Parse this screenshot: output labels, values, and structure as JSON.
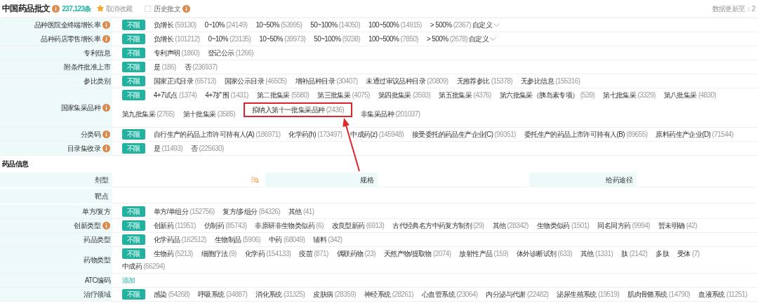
{
  "header": {
    "title": "中国药品批文",
    "count": "237,123条",
    "favorited": true,
    "favorite": "取消收藏",
    "history": {
      "label": "历史批文",
      "checked": false
    },
    "updated": "数据更新至：2"
  },
  "filters": [
    {
      "label": "品种医院全终端增长率",
      "info": true,
      "custom": "自定义",
      "options": [
        {
          "label": "不限",
          "selected": true
        },
        {
          "label": "负增长",
          "count": "(59130)",
          "selected": false
        },
        {
          "label": "0~10%",
          "count": "(24149)",
          "selected": false
        },
        {
          "label": "10~50%",
          "count": "(53995)",
          "selected": false
        },
        {
          "label": "50~100%",
          "count": "(14050)",
          "selected": false
        },
        {
          "label": "100~500%",
          "count": "(14915)",
          "selected": false
        },
        {
          "label": "> 500%",
          "count": "(2367)",
          "selected": false
        }
      ]
    },
    {
      "label": "品种药店零售增长率",
      "info": true,
      "custom": "自定义",
      "options": [
        {
          "label": "不限",
          "selected": true
        },
        {
          "label": "负增长",
          "count": "(101212)",
          "selected": false
        },
        {
          "label": "0~10%",
          "count": "(23135)",
          "selected": false
        },
        {
          "label": "10~50%",
          "count": "(39973)",
          "selected": false
        },
        {
          "label": "50~100%",
          "count": "(9238)",
          "selected": false
        },
        {
          "label": "100~500%",
          "count": "(7850)",
          "selected": false
        },
        {
          "label": "> 500%",
          "count": "(2678)",
          "selected": false
        }
      ]
    },
    {
      "label": "专利信息",
      "info": false,
      "options": [
        {
          "label": "不限",
          "selected": true
        },
        {
          "label": "专利声明",
          "count": "(1860)",
          "selected": false
        },
        {
          "label": "登记公示",
          "count": "(1266)",
          "selected": false
        }
      ]
    },
    {
      "label": "附条件批准上市",
      "info": false,
      "options": [
        {
          "label": "不限",
          "selected": true
        },
        {
          "label": "是",
          "count": "(186)",
          "selected": false
        },
        {
          "label": "否",
          "count": "(236937)",
          "selected": false
        }
      ]
    },
    {
      "label": "参比类别",
      "info": false,
      "options": [
        {
          "label": "不限",
          "selected": true
        },
        {
          "label": "国家正式目录",
          "count": "(65713)",
          "selected": false
        },
        {
          "label": "国家公示目录",
          "count": "(46505)",
          "selected": false
        },
        {
          "label": "增补品种目录",
          "count": "(30407)",
          "selected": false
        },
        {
          "label": "未通过审议品种目录",
          "count": "(20809)",
          "selected": false
        },
        {
          "label": "无推荐参比",
          "count": "(15378)",
          "selected": false
        },
        {
          "label": "无参比信息",
          "count": "(155316)",
          "selected": false
        }
      ]
    },
    {
      "label": "国家集采品种",
      "info": true,
      "options": [
        {
          "label": "不限",
          "selected": true
        },
        {
          "label": "4+7试点",
          "count": "(1374)",
          "selected": false
        },
        {
          "label": "4+7扩围",
          "count": "(1431)",
          "selected": false
        },
        {
          "label": "第二批集采",
          "count": "(5580)",
          "selected": false
        },
        {
          "label": "第三批集采",
          "count": "(4075)",
          "selected": false
        },
        {
          "label": "第四批集采",
          "count": "(3593)",
          "selected": false
        },
        {
          "label": "第五批集采",
          "count": "(4376)",
          "selected": false
        },
        {
          "label": "第六批集采（胰岛素专项）",
          "count": "(539)",
          "selected": false
        },
        {
          "label": "第七批集采",
          "count": "(3329)",
          "selected": false
        },
        {
          "label": "第八批集采",
          "count": "(4830)",
          "selected": false
        },
        {
          "label": "第九批集采",
          "count": "(2765)",
          "selected": false
        },
        {
          "label": "第十批集采",
          "count": "(3585)",
          "selected": false
        },
        {
          "label": "拟纳入第十一批集采品种",
          "count": "(2436)",
          "selected": false,
          "highlighted": true
        },
        {
          "label": "非集采品种",
          "count": "(201037)",
          "selected": false
        }
      ]
    },
    {
      "label": "分类码",
      "info": true,
      "options": [
        {
          "label": "不限",
          "selected": true
        },
        {
          "label": "自行生产的药品上市许可持有人(A)",
          "count": "(186971)",
          "selected": false
        },
        {
          "label": "化学药(h)",
          "count": "(173497)",
          "selected": false
        },
        {
          "label": "中成药(z)",
          "count": "(145948)",
          "selected": false
        },
        {
          "label": "接受委托的药品生产企业(C)",
          "count": "(99351)",
          "selected": false
        },
        {
          "label": "委托生产的药品上市许可持有人(B)",
          "count": "(89655)",
          "selected": false
        },
        {
          "label": "原料药生产企业(D)",
          "count": "(71544)",
          "selected": false
        }
      ]
    },
    {
      "label": "目录集收录",
      "info": true,
      "options": [
        {
          "label": "不限",
          "selected": true
        },
        {
          "label": "是",
          "count": "(11493)",
          "selected": false
        },
        {
          "label": "否",
          "count": "(225630)",
          "selected": false
        }
      ]
    }
  ],
  "drug_info": {
    "title": "药品信息",
    "fields": [
      [
        {
          "label": "剂型",
          "search_icon": true
        },
        {
          "label": "规格",
          "search_icon": false
        },
        {
          "label": "给药途径",
          "search_icon": false
        }
      ],
      [
        {
          "label": "靶点",
          "search_icon": false
        }
      ]
    ],
    "filters": [
      {
        "label": "单方/复方",
        "info": false,
        "options": [
          {
            "label": "不限",
            "selected": true
          },
          {
            "label": "单方/单组分",
            "count": "(152756)",
            "selected": false
          },
          {
            "label": "复方/多组分",
            "count": "(84326)",
            "selected": false
          },
          {
            "label": "其他",
            "count": "(41)",
            "selected": false
          }
        ]
      },
      {
        "label": "创新类型",
        "info": true,
        "options": [
          {
            "label": "不限",
            "selected": true
          },
          {
            "label": "创新药",
            "count": "(11951)",
            "selected": false
          },
          {
            "label": "仿制药",
            "count": "(85743)",
            "selected": false
          },
          {
            "label": "非原研非生物类似药",
            "count": "(6)",
            "selected": false
          },
          {
            "label": "改良型新药",
            "count": "(6913)",
            "selected": false
          },
          {
            "label": "古代经典名方中药复方制剂",
            "count": "(29)",
            "selected": false
          },
          {
            "label": "其他",
            "count": "(28342)",
            "selected": false
          },
          {
            "label": "生物类似药",
            "count": "(1501)",
            "selected": false
          },
          {
            "label": "同名同方药",
            "count": "(9994)",
            "selected": false
          },
          {
            "label": "暂未明确",
            "count": "(42)",
            "selected": false
          }
        ]
      },
      {
        "label": "药品类型",
        "info": false,
        "options": [
          {
            "label": "不限",
            "selected": true
          },
          {
            "label": "化学药品",
            "count": "(162512)",
            "selected": false
          },
          {
            "label": "生物制品",
            "count": "(5906)",
            "selected": false
          },
          {
            "label": "中药",
            "count": "(68049)",
            "selected": false
          },
          {
            "label": "辅料",
            "count": "(342)",
            "selected": false
          }
        ]
      },
      {
        "label": "药物类型",
        "info": false,
        "options": [
          {
            "label": "不限",
            "selected": true
          },
          {
            "label": "生物药",
            "count": "(5213)",
            "selected": false
          },
          {
            "label": "细胞疗法",
            "count": "(9)",
            "selected": false
          },
          {
            "label": "化学药",
            "count": "(154133)",
            "selected": false
          },
          {
            "label": "疫苗",
            "count": "(871)",
            "selected": false
          },
          {
            "label": "偶联药物",
            "count": "(23)",
            "selected": false
          },
          {
            "label": "天然产物/提取物",
            "count": "(2074)",
            "selected": false
          },
          {
            "label": "放射性产品",
            "count": "(159)",
            "selected": false
          },
          {
            "label": "体外诊断试剂",
            "count": "(633)",
            "selected": false
          },
          {
            "label": "其他",
            "count": "(1331)",
            "selected": false
          },
          {
            "label": "肽",
            "count": "(2142)",
            "selected": false
          },
          {
            "label": "多肽",
            "selected": false
          },
          {
            "label": "受体",
            "count": "(7)",
            "selected": false
          },
          {
            "label": "中成药",
            "count": "(66294)",
            "selected": false
          }
        ]
      },
      {
        "label": "ATC编码",
        "info": false,
        "add": "添加"
      },
      {
        "label": "治疗领域",
        "info": false,
        "options": [
          {
            "label": "不限",
            "selected": true
          },
          {
            "label": "感染",
            "count": "(54268)",
            "selected": false
          },
          {
            "label": "呼吸系统",
            "count": "(34887)",
            "selected": false
          },
          {
            "label": "消化系统",
            "count": "(31325)",
            "selected": false
          },
          {
            "label": "皮肤病",
            "count": "(28359)",
            "selected": false
          },
          {
            "label": "神经系统",
            "count": "(28261)",
            "selected": false
          },
          {
            "label": "心血管系统",
            "count": "(23064)",
            "selected": false
          },
          {
            "label": "内分泌与代谢",
            "count": "(22482)",
            "selected": false
          },
          {
            "label": "泌尿生殖系统",
            "count": "(19519)",
            "selected": false
          },
          {
            "label": "肌肉骨骼系统",
            "count": "(14790)",
            "selected": false
          },
          {
            "label": "血液系统",
            "count": "(11251)",
            "selected": false
          }
        ]
      }
    ]
  },
  "annotation": {
    "arrow": true
  }
}
